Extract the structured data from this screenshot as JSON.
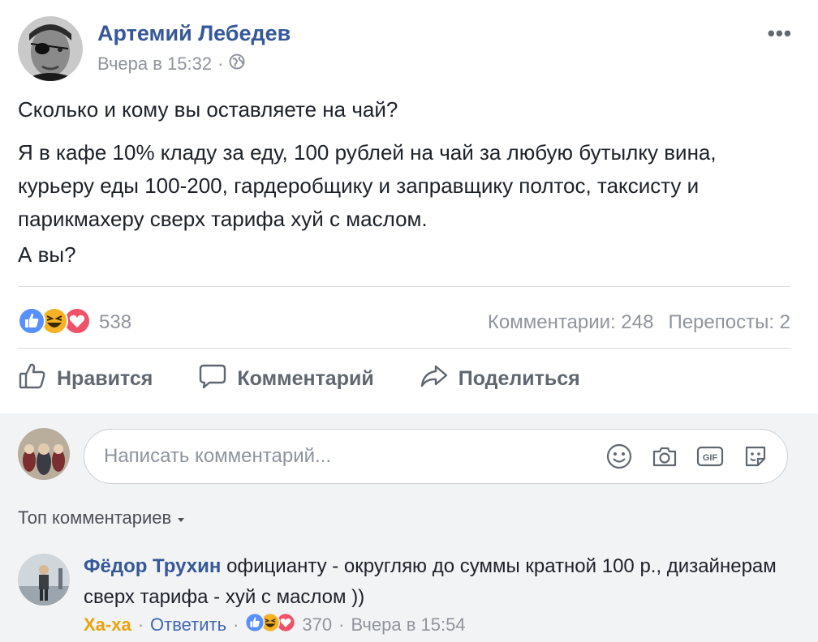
{
  "post": {
    "author": "Артемий Лебедев",
    "time": "Вчера в 15:32",
    "privacy_icon": "globe-icon",
    "more": "•••",
    "paragraphs": [
      "Сколько и кому вы оставляете на чай?",
      "Я в кафе 10% кладу за еду, 100 рублей на чай за любую бутылку вина, курьеру еды 100-200, гардеробщику и заправщику полтос, таксисту и парикмахеру сверх тарифа хуй с маслом.",
      "А вы?"
    ]
  },
  "stats": {
    "reactions_count": "538",
    "comments": "Комментарии: 248",
    "shares": "Перепосты: 2",
    "reaction_icons": [
      "like-icon",
      "haha-icon",
      "love-icon"
    ]
  },
  "actions": {
    "like": "Нравится",
    "comment": "Комментарий",
    "share": "Поделиться"
  },
  "composer": {
    "placeholder": "Написать комментарий...",
    "icons": [
      "emoji-icon",
      "camera-icon",
      "gif-icon",
      "sticker-icon"
    ]
  },
  "sort": {
    "label": "Топ комментариев"
  },
  "comment": {
    "author": "Фёдор Трухин",
    "text": "официанту - округляю до суммы кратной 100 р., дизайнерам сверх тарифа - хуй с маслом ))",
    "reaction_label": "Ха-ха",
    "reply": "Ответить",
    "reactions_count": "370",
    "time": "Вчера в 15:54"
  },
  "colors": {
    "link": "#365899",
    "muted": "#90949c",
    "like_blue": "#4267b2",
    "haha_yellow": "#f7b125",
    "love_red": "#f25268"
  }
}
